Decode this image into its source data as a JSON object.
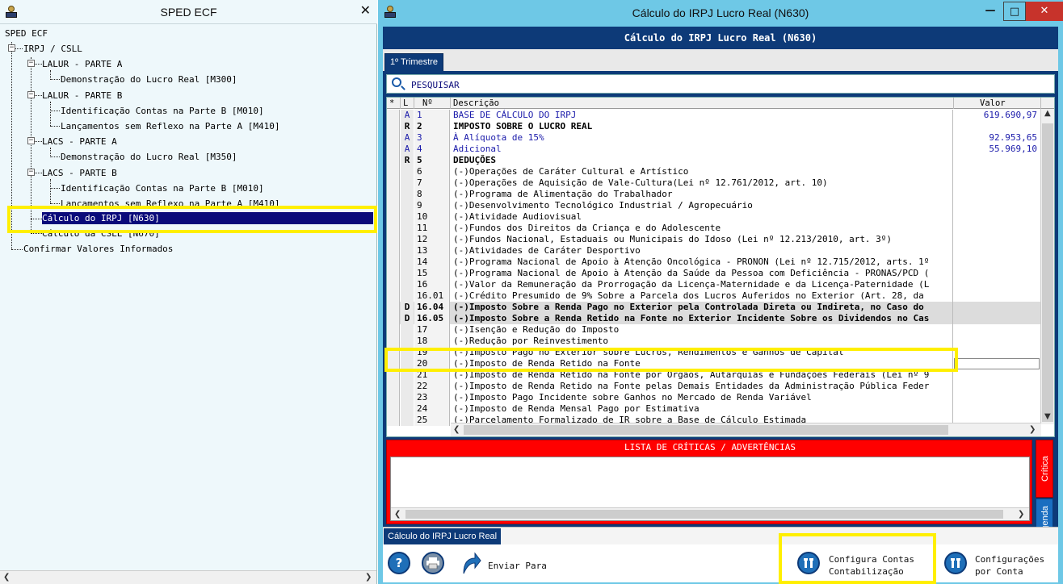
{
  "left_panel": {
    "title": "SPED ECF",
    "tree": [
      {
        "label": "SPED ECF"
      },
      {
        "label": "IRPJ / CSLL"
      },
      {
        "label": "LALUR - PARTE A"
      },
      {
        "label": "Demonstração do Lucro Real [M300]"
      },
      {
        "label": "LALUR - PARTE B"
      },
      {
        "label": "Identificação Contas na Parte B [M010]"
      },
      {
        "label": "Lançamentos sem Reflexo na Parte A [M410]"
      },
      {
        "label": "LACS - PARTE A"
      },
      {
        "label": "Demonstração do Lucro Real [M350]"
      },
      {
        "label": "LACS - PARTE B"
      },
      {
        "label": "Identificação Contas na Parte B [M010]"
      },
      {
        "label": "Lançamentos sem Reflexo na Parte A [M410]"
      },
      {
        "label": "Cálculo do IRPJ [N630]"
      },
      {
        "label": "Cálculo da CSLL [N670]"
      },
      {
        "label": "Confirmar Valores Informados"
      }
    ]
  },
  "window": {
    "title": "Cálculo do IRPJ Lucro Real (N630)",
    "controls": {
      "minimize": "—",
      "maximize": "□",
      "close": "✕"
    },
    "header": "Cálculo do IRPJ Lucro Real (N630)",
    "tab": "1º Trimestre",
    "search_placeholder": "PESQUISAR",
    "columns": {
      "star": "*",
      "l": "L",
      "n": "Nº",
      "desc": "Descrição",
      "value": "Valor"
    },
    "rows": [
      {
        "l": "A",
        "n": "1",
        "desc": "BASE DE CÁLCULO DO IRPJ",
        "value": "619.690,97"
      },
      {
        "l": "R",
        "n": "2",
        "desc": "IMPOSTO SOBRE O LUCRO REAL",
        "value": ""
      },
      {
        "l": "A",
        "n": "3",
        "desc": "À Alíquota de 15%",
        "value": "92.953,65"
      },
      {
        "l": "A",
        "n": "4",
        "desc": "Adicional",
        "value": "55.969,10"
      },
      {
        "l": "R",
        "n": "5",
        "desc": "DEDUÇÕES",
        "value": ""
      },
      {
        "l": "",
        "n": "6",
        "desc": "(-)Operações de Caráter Cultural e Artístico",
        "value": ""
      },
      {
        "l": "",
        "n": "7",
        "desc": "(-)Operações de Aquisição de Vale-Cultura(Lei nº 12.761/2012, art. 10)",
        "value": ""
      },
      {
        "l": "",
        "n": "8",
        "desc": "(-)Programa de Alimentação do Trabalhador",
        "value": ""
      },
      {
        "l": "",
        "n": "9",
        "desc": "(-)Desenvolvimento Tecnológico Industrial / Agropecuário",
        "value": ""
      },
      {
        "l": "",
        "n": "10",
        "desc": "(-)Atividade Audiovisual",
        "value": ""
      },
      {
        "l": "",
        "n": "11",
        "desc": "(-)Fundos dos Direitos da Criança e do Adolescente",
        "value": ""
      },
      {
        "l": "",
        "n": "12",
        "desc": "(-)Fundos Nacional, Estaduais ou Municipais do Idoso (Lei nº 12.213/2010, art. 3º)",
        "value": ""
      },
      {
        "l": "",
        "n": "13",
        "desc": "(-)Atividades de Caráter Desportivo",
        "value": ""
      },
      {
        "l": "",
        "n": "14",
        "desc": "(-)Programa Nacional de Apoio à Atenção Oncológica - PRONON (Lei nº 12.715/2012, arts. 1º",
        "value": ""
      },
      {
        "l": "",
        "n": "15",
        "desc": "(-)Programa Nacional de Apoio à Atenção da Saúde da Pessoa com Deficiência - PRONAS/PCD (",
        "value": ""
      },
      {
        "l": "",
        "n": "16",
        "desc": "(-)Valor da Remuneração da Prorrogação da Licença-Maternidade e da Licença-Paternidade (L",
        "value": ""
      },
      {
        "l": "",
        "n": "16.01",
        "desc": "(-)Crédito Presumido de 9% Sobre a Parcela dos Lucros Auferidos no Exterior (Art. 28, da",
        "value": ""
      },
      {
        "l": "D",
        "n": "16.04",
        "desc": "(-)Imposto Sobre a Renda Pago no Exterior pela Controlada Direta ou Indireta, no Caso do",
        "value": ""
      },
      {
        "l": "D",
        "n": "16.05",
        "desc": "(-)Imposto Sobre a Renda Retido na Fonte no Exterior Incidente Sobre os Dividendos no Cas",
        "value": ""
      },
      {
        "l": "",
        "n": "17",
        "desc": "(-)Isenção e Redução do Imposto",
        "value": ""
      },
      {
        "l": "",
        "n": "18",
        "desc": "(-)Redução por Reinvestimento",
        "value": ""
      },
      {
        "l": "",
        "n": "19",
        "desc": "(-)Imposto Pago no Exterior sobre Lucros, Rendimentos e Ganhos de Capital",
        "value": ""
      },
      {
        "l": "",
        "n": "20",
        "desc": "(-)Imposto de Renda Retido na Fonte",
        "value": ""
      },
      {
        "l": "",
        "n": "21",
        "desc": "(-)Imposto de Renda Retido na Fonte por Órgãos, Autarquias e Fundações Federais (Lei nº 9",
        "value": ""
      },
      {
        "l": "",
        "n": "22",
        "desc": "(-)Imposto de Renda Retido na Fonte pelas Demais Entidades da Administração Pública Feder",
        "value": ""
      },
      {
        "l": "",
        "n": "23",
        "desc": "(-)Imposto Pago Incidente sobre Ganhos no Mercado de Renda Variável",
        "value": ""
      },
      {
        "l": "",
        "n": "24",
        "desc": "(-)Imposto de Renda Mensal Pago por Estimativa",
        "value": ""
      },
      {
        "l": "",
        "n": "25",
        "desc": "(-)Parcelamento Formalizado de IR sobre a Base de Cálculo Estimada",
        "value": ""
      }
    ],
    "criticas_title": "LISTA DE CRÍTICAS / ADVERTÊNCIAS",
    "side_tabs": {
      "critica": "Crítica",
      "legenda": "Legenda"
    },
    "bottom_tab": "Cálculo do IRPJ Lucro Real",
    "toolbar": {
      "help": "?",
      "enviar_para": "Enviar Para",
      "configura_1": "Configura Contas",
      "configura_2": "Contabilização",
      "config_conta_1": "Configurações",
      "config_conta_2": "por Conta"
    }
  }
}
